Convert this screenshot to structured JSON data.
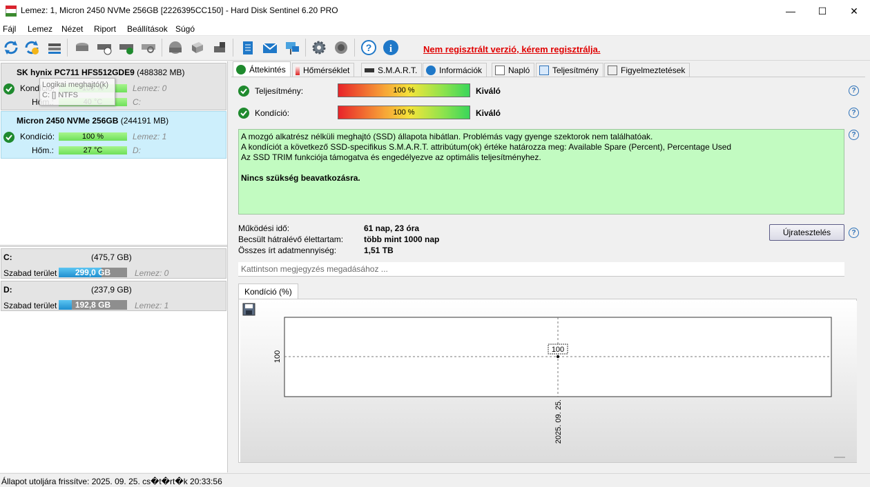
{
  "window": {
    "title": "Lemez: 1, Micron 2450 NVMe 256GB [2226395CC150]  -  Hard Disk Sentinel 6.20 PRO",
    "minimize": "—",
    "maximize": "☐",
    "close": "✕"
  },
  "menu": [
    "Fájl",
    "Lemez",
    "Nézet",
    "Riport",
    "Beállítások",
    "Súgó"
  ],
  "toolbar": {
    "register_link": "Nem regisztrált verzió, kérem regisztrálja."
  },
  "disks": [
    {
      "name": "SK hynix PC711 HFS512GDE9",
      "size": "(488382 MB)",
      "condition_label": "Kondíció:",
      "condition_value": "100 %",
      "condition_fraction": 1.0,
      "disk_label": "Lemez: 0",
      "temp_label": "Hőm.:",
      "temp_value": "40 °C",
      "drive_letter": "C:",
      "tooltip_line1": "Logikai meghajtó(k)",
      "tooltip_line2": "C: [] NTFS"
    },
    {
      "name": "Micron 2450 NVMe 256GB",
      "size": "(244191 MB)",
      "condition_label": "Kondíció:",
      "condition_value": "100 %",
      "condition_fraction": 1.0,
      "disk_label": "Lemez: 1",
      "temp_label": "Hőm.:",
      "temp_value": "27 °C",
      "drive_letter": "D:"
    }
  ],
  "volumes": [
    {
      "letter": "C:",
      "size": "(475,7 GB)",
      "free_label": "Szabad terület",
      "free_value": "299,0 GB",
      "free_fraction": 0.63,
      "disk": "Lemez: 0"
    },
    {
      "letter": "D:",
      "size": "(237,9 GB)",
      "free_label": "Szabad terület",
      "free_value": "192,8 GB",
      "free_fraction": 0.19,
      "disk": "Lemez: 1"
    }
  ],
  "tabs": [
    "Áttekintés",
    "Hőmérséklet",
    "S.M.A.R.T.",
    "Információk",
    "Napló",
    "Teljesítmény",
    "Figyelmeztetések"
  ],
  "overview": {
    "performance_label": "Teljesítmény:",
    "performance_value": "100 %",
    "performance_rating": "Kiváló",
    "condition_label": "Kondíció:",
    "condition_value": "100 %",
    "condition_rating": "Kiváló",
    "info_lines": [
      "A mozgó alkatrész nélküli meghajtó (SSD) állapota hibátlan. Problémás vagy gyenge szektorok nem találhatóak.",
      "A kondíciót a következő SSD-specifikus S.M.A.R.T. attribútum(ok) értéke határozza meg:  Available Spare (Percent), Percentage Used",
      "Az SSD TRIM funkciója támogatva és engedélyezve az optimális teljesítményhez."
    ],
    "info_bold": "Nincs szükség beavatkozásra.",
    "uptime_label": "Működési idő:",
    "uptime_value": "61 nap, 23 óra",
    "lifetime_label": "Becsült hátralévő élettartam:",
    "lifetime_value": "több mint 1000 nap",
    "written_label": "Összes írt adatmennyiség:",
    "written_value": "1,51 TB",
    "retest_button": "Újratesztelés",
    "note_placeholder": "Kattintson megjegyzés megadásához ...",
    "chart_tab": "Kondíció  (%)"
  },
  "chart_data": {
    "type": "line",
    "x": [
      "2025. 09. 25."
    ],
    "series": [
      {
        "values": [
          100
        ]
      }
    ],
    "point_labels": [
      "100"
    ],
    "ytick": "100",
    "xtick": "2025. 09. 25."
  },
  "status": {
    "text": "Állapot utoljára frissítve: 2025. 09. 25. cs�t�rt�k 20:33:56"
  }
}
